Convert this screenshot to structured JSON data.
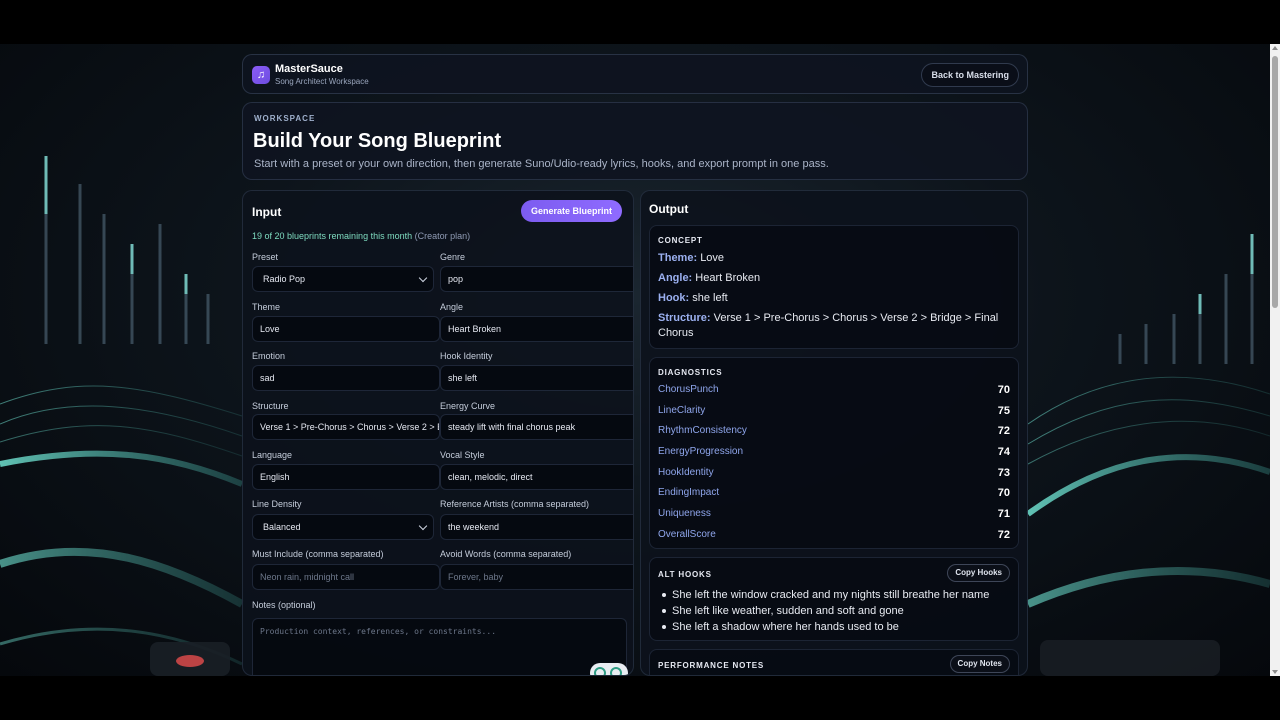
{
  "header": {
    "brand_name": "MasterSauce",
    "brand_subtitle": "Song Architect Workspace",
    "logo_icon": "music-note-icon",
    "back_label": "Back to Mastering"
  },
  "hero": {
    "eyebrow": "WORKSPACE",
    "title": "Build Your Song Blueprint",
    "subtitle": "Start with a preset or your own direction, then generate Suno/Udio-ready lyrics, hooks, and export prompt in one pass."
  },
  "input": {
    "title": "Input",
    "generate_label": "Generate Blueprint",
    "quota_text": "19 of 20 blueprints remaining this month",
    "quota_plan": "(Creator plan)",
    "fields": {
      "preset": {
        "label": "Preset",
        "value": "Radio Pop"
      },
      "genre": {
        "label": "Genre",
        "value": "pop"
      },
      "theme": {
        "label": "Theme",
        "value": "Love"
      },
      "angle": {
        "label": "Angle",
        "value": "Heart Broken"
      },
      "emotion": {
        "label": "Emotion",
        "value": "sad"
      },
      "hook_identity": {
        "label": "Hook Identity",
        "value": "she left"
      },
      "structure": {
        "label": "Structure",
        "value": "Verse 1 > Pre-Chorus > Chorus > Verse 2 > Bridge > Final Chorus"
      },
      "energy_curve": {
        "label": "Energy Curve",
        "value": "steady lift with final chorus peak"
      },
      "language": {
        "label": "Language",
        "value": "English"
      },
      "vocal_style": {
        "label": "Vocal Style",
        "value": "clean, melodic, direct"
      },
      "line_density": {
        "label": "Line Density",
        "value": "Balanced"
      },
      "reference_artists": {
        "label": "Reference Artists (comma separated)",
        "value": "the weekend"
      },
      "must_include": {
        "label": "Must Include (comma separated)",
        "placeholder": "Neon rain, midnight call"
      },
      "avoid_words": {
        "label": "Avoid Words (comma separated)",
        "placeholder": "Forever, baby"
      },
      "notes": {
        "label": "Notes (optional)",
        "placeholder": "Production context, references, or constraints..."
      }
    }
  },
  "output": {
    "title": "Output",
    "concept": {
      "heading": "CONCEPT",
      "theme_key": "Theme:",
      "theme": "Love",
      "angle_key": "Angle:",
      "angle": "Heart Broken",
      "hook_key": "Hook:",
      "hook": "she left",
      "structure_key": "Structure:",
      "structure_line1": "Verse 1 > Pre-Chorus > Chorus > Verse 2 > Bridge > Final",
      "structure_line2": "Chorus"
    },
    "diagnostics": {
      "heading": "DIAGNOSTICS",
      "items": [
        {
          "name": "ChorusPunch",
          "score": "70"
        },
        {
          "name": "LineClarity",
          "score": "75"
        },
        {
          "name": "RhythmConsistency",
          "score": "72"
        },
        {
          "name": "EnergyProgression",
          "score": "74"
        },
        {
          "name": "HookIdentity",
          "score": "73"
        },
        {
          "name": "EndingImpact",
          "score": "70"
        },
        {
          "name": "Uniqueness",
          "score": "71"
        },
        {
          "name": "OverallScore",
          "score": "72"
        }
      ]
    },
    "alt_hooks": {
      "heading": "ALT HOOKS",
      "copy_label": "Copy Hooks",
      "items": [
        "She left the window cracked and my nights still breathe her name",
        "She left like weather, sudden and soft and gone",
        "She left a shadow where her hands used to be"
      ]
    },
    "performance_notes": {
      "heading": "PERFORMANCE NOTES",
      "copy_label": "Copy Notes"
    }
  }
}
